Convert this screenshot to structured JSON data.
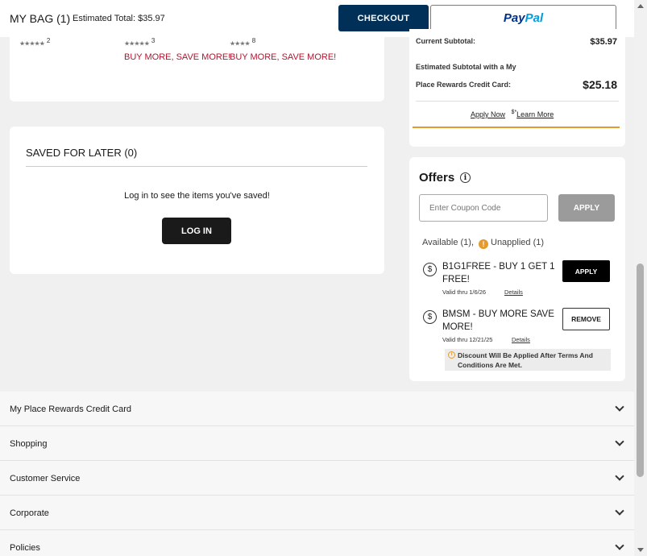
{
  "header": {
    "bag_title": "MY BAG (1)",
    "estimated_total": "Estimated Total: $35.97",
    "checkout_label": "CHECKOUT",
    "paypal_label_1": "Pay",
    "paypal_label_2": "Pal"
  },
  "products": [
    {
      "stars": "★★★★★",
      "count": "2",
      "promo": ""
    },
    {
      "stars": "★★★★★",
      "count": "3",
      "promo": "BUY MORE, SAVE MORE!"
    },
    {
      "stars": "★★★★",
      "count": "8",
      "promo": "BUY MORE, SAVE MORE!"
    }
  ],
  "saved": {
    "title": "SAVED FOR LATER (0)",
    "message": "Log in to see the items you've saved!",
    "login_label": "LOG IN"
  },
  "subtotal": {
    "current_label": "Current Subtotal:",
    "current_value": "$35.97",
    "rewards_label_1": "Estimated Subtotal with a My",
    "rewards_label_2": "Place Rewards Credit Card:",
    "rewards_value": "$25.18",
    "apply_now": "Apply Now",
    "dollar_sup": "$*",
    "learn_more": "Learn More"
  },
  "offers": {
    "title": "Offers",
    "coupon_placeholder": "Enter Coupon Code",
    "apply_label": "APPLY",
    "available": "Available (1),",
    "unapplied": "Unapplied (1)",
    "items": [
      {
        "name": "B1G1FREE - BUY 1 GET 1 FREE!",
        "valid": "Valid thru 1/6/26",
        "details": "Details",
        "action": "APPLY"
      },
      {
        "name": "BMSM - BUY MORE SAVE MORE!",
        "valid": "Valid thru 12/21/25",
        "details": "Details",
        "action": "REMOVE"
      }
    ],
    "discount_note": "Discount Will Be Applied After Terms And Conditions Are Met."
  },
  "footer": {
    "items": [
      {
        "label": "My Place Rewards Credit Card"
      },
      {
        "label": "Shopping"
      },
      {
        "label": "Customer Service"
      },
      {
        "label": "Corporate"
      },
      {
        "label": "Policies"
      }
    ]
  },
  "colors": {
    "checkout_bg": "#003057",
    "promo_red": "#b3142f",
    "accent_orange": "#e59a2f"
  }
}
